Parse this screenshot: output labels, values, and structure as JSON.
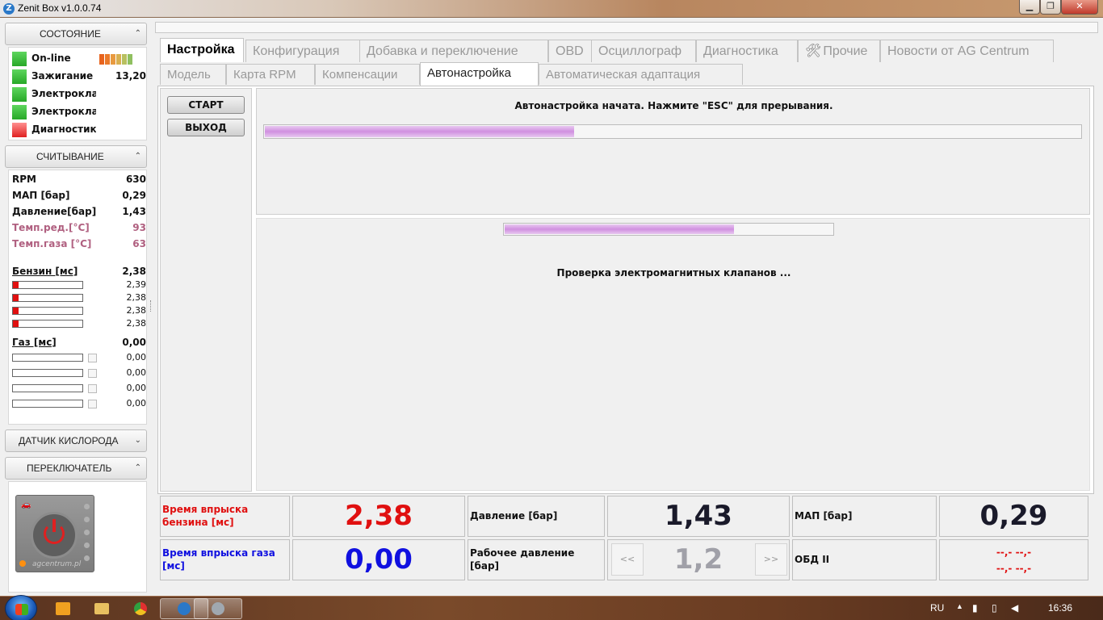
{
  "window": {
    "title": "Zenit Box v1.0.0.74",
    "min_glyph": "▁",
    "max_glyph": "❐",
    "close_glyph": "✕"
  },
  "left": {
    "status": {
      "header": "СОСТОЯНИЕ",
      "rows": [
        {
          "label": "On-line",
          "value": "",
          "led": "green"
        },
        {
          "label": "Зажигание",
          "value": "13,20",
          "led": "green"
        },
        {
          "label": "Электроклапан",
          "value": "",
          "led": "green"
        },
        {
          "label": "Электроклапан",
          "value": "",
          "led": "green"
        },
        {
          "label": "Диагностика",
          "value": "",
          "led": "red"
        }
      ],
      "signal_colors": [
        "#e8641e",
        "#ea7a2a",
        "#e89a40",
        "#d8b050",
        "#b8c060",
        "#90c060"
      ]
    },
    "reading": {
      "header": "СЧИТЫВАНИЕ",
      "rpm_label": "RPM",
      "rpm_value": "630",
      "map_label": "МАП [бар]",
      "map_value": "0,29",
      "pressure_label": "Давление[бар]",
      "pressure_value": "1,43",
      "temp_red_label": "Темп.ред.[°C]",
      "temp_red_value": "93",
      "temp_gas_label": "Темп.газа [°C]",
      "temp_gas_value": "63",
      "petrol_label": "Бензин [мс]",
      "petrol_value": "2,38",
      "petrol_cyl": [
        {
          "value": "2,39",
          "level": 0.1
        },
        {
          "value": "2,38",
          "level": 0.1
        },
        {
          "value": "2,38",
          "level": 0.1
        },
        {
          "value": "2,38",
          "level": 0.1
        }
      ],
      "gas_label": "Газ [мс]",
      "gas_value": "0,00",
      "gas_cyl": [
        {
          "value": "0,00",
          "level": 0
        },
        {
          "value": "0,00",
          "level": 0
        },
        {
          "value": "0,00",
          "level": 0
        },
        {
          "value": "0,00",
          "level": 0
        }
      ]
    },
    "oxygen_header": "ДАТЧИК КИСЛОРОДА",
    "switch_header": "ПЕРЕКЛЮЧАТЕЛЬ",
    "switch_brand": "agcentrum.pl",
    "arrow_up": "⌃",
    "arrow_down": "⌄"
  },
  "tabs_main": [
    {
      "label": "Настройка",
      "active": true
    },
    {
      "label": "Конфигурация",
      "active": false
    },
    {
      "label": "Добавка и переключение",
      "active": false
    },
    {
      "label": "OBD",
      "active": false
    },
    {
      "label": "Осциллограф",
      "active": false
    },
    {
      "label": "Диагностика",
      "active": false
    },
    {
      "label": "Прочие",
      "active": false
    },
    {
      "label": "Новости от AG Centrum",
      "active": false
    }
  ],
  "tabs_sub": [
    {
      "label": "Модель",
      "active": false
    },
    {
      "label": "Карта RPM",
      "active": false
    },
    {
      "label": "Компенсации",
      "active": false
    },
    {
      "label": "Автонастройка",
      "active": true
    },
    {
      "label": "Автоматическая адаптация",
      "active": false
    }
  ],
  "tools_icon": "wrench-screwdriver-icon",
  "autotune": {
    "start_label": "СТАРТ",
    "exit_label": "ВЫХОД",
    "status_text": "Автонастройка начата. Нажмите \"ESC\" для прерывания.",
    "main_progress": 0.38,
    "step_progress": 0.7,
    "step_text": "Проверка электромагнитных клапанов ..."
  },
  "bottom": {
    "petrol_inj_label": "Время впрыска бензина [мс]",
    "petrol_inj_value": "2,38",
    "gas_inj_label": "Время впрыска газа [мс]",
    "gas_inj_value": "0,00",
    "pressure_label": "Давление [бар]",
    "pressure_value": "1,43",
    "work_pressure_label": "Рабочее давление [бар]",
    "work_pressure_value": "1,2",
    "prev_label": "<<",
    "next_label": ">>",
    "map_label": "МАП [бар]",
    "map_value": "0,29",
    "obd_label": "ОБД II",
    "obd_value1": "--,- --,-",
    "obd_value2": "--,- --,-",
    "colors": {
      "petrol": "#e01010",
      "gas": "#1010e0",
      "neutral": "#1a1a2a",
      "disabled": "#a0a0a8"
    }
  },
  "taskbar": {
    "lang": "RU",
    "time": "16:36",
    "apps": [
      "media-player-icon",
      "folder-icon",
      "chrome-icon",
      "zenit-app-icon",
      "settings-app-icon"
    ]
  }
}
